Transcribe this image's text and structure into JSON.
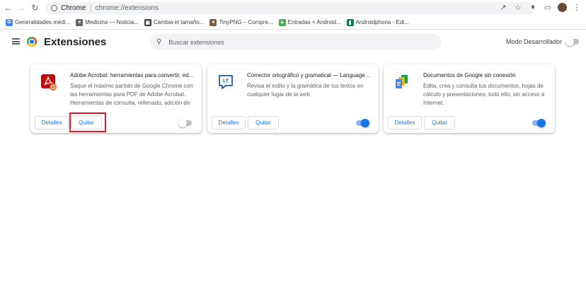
{
  "browser": {
    "omnibox_site": "Chrome",
    "omnibox_url": "chrome://extensions"
  },
  "bookmarks": [
    {
      "label": "Generalidades médi...",
      "icon": "google-icon",
      "color": "#4285f4"
    },
    {
      "label": "Medicina — Noticia...",
      "icon": "medicina-icon",
      "color": "#5f6368"
    },
    {
      "label": "Cambia el tamaño...",
      "icon": "resize-icon",
      "color": "#3c4043"
    },
    {
      "label": "TinyPNG – Compre...",
      "icon": "tinypng-icon",
      "color": "#7c5c3a"
    },
    {
      "label": "Entradas < Android...",
      "icon": "wordpress-icon",
      "color": "#4caf50"
    },
    {
      "label": "Androidphoria - Edi...",
      "icon": "trello-icon",
      "color": "#0b8043"
    }
  ],
  "header": {
    "title": "Extensiones",
    "search_placeholder": "Buscar extensiones",
    "dev_mode_label": "Modo Desarrollador",
    "dev_mode_on": false
  },
  "extensions": [
    {
      "name": "Adobe Acrobat: herramientas para convertir, ed...",
      "description": "Saque el máximo partido de Google Chrome con las herramientas para PDF de Adobe Acrobat. Herramientas de consulta, rellenado, adición de",
      "details_label": "Detalles",
      "remove_label": "Quitar",
      "enabled": false,
      "icon": "adobe-acrobat-icon"
    },
    {
      "name": "Corrector ortográfico y gramatical — Language...",
      "description": "Revisa el estilo y la gramática de tus textos en cualquier lugar de la web",
      "details_label": "Detalles",
      "remove_label": "Quitar",
      "enabled": true,
      "icon": "languagetool-icon"
    },
    {
      "name": "Documentos de Google sin conexión",
      "description": "Edita, crea y consulta tus documentos, hojas de cálculo y presentaciones; todo ello, sin acceso a Internet.",
      "details_label": "Detalles",
      "remove_label": "Quitar",
      "enabled": true,
      "icon": "google-docs-offline-icon"
    }
  ],
  "colors": {
    "accent": "#1a73e8",
    "highlight": "#e0182d"
  }
}
